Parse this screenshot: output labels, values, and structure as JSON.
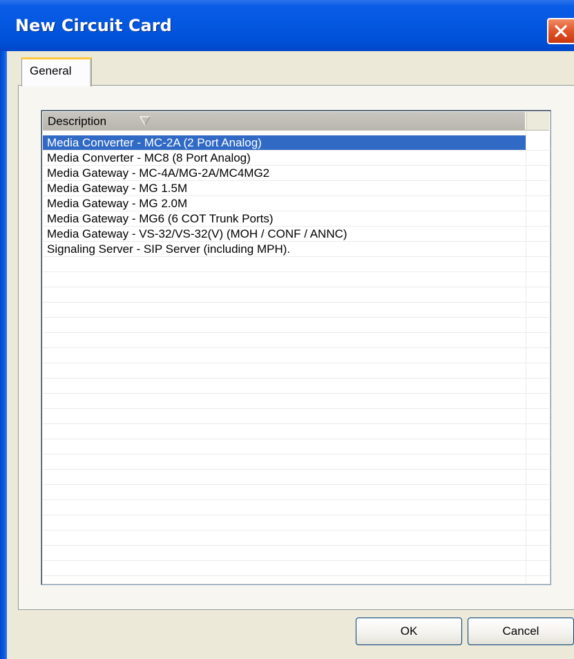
{
  "window": {
    "title": "New Circuit Card"
  },
  "tabs": [
    {
      "label": "General",
      "selected": true
    }
  ],
  "listview": {
    "columns": [
      {
        "label": "Description",
        "sort": "descending"
      }
    ],
    "rows": [
      {
        "label": "Media Converter - MC-2A (2 Port Analog)",
        "selected": true
      },
      {
        "label": "Media Converter - MC8 (8 Port Analog)",
        "selected": false
      },
      {
        "label": "Media Gateway - MC-4A/MG-2A/MC4MG2",
        "selected": false
      },
      {
        "label": "Media Gateway - MG 1.5M",
        "selected": false
      },
      {
        "label": "Media Gateway - MG 2.0M",
        "selected": false
      },
      {
        "label": "Media Gateway - MG6 (6 COT Trunk Ports)",
        "selected": false
      },
      {
        "label": "Media Gateway - VS-32/VS-32(V) (MOH / CONF / ANNC)",
        "selected": false
      },
      {
        "label": "Signaling Server - SIP Server (including MPH).",
        "selected": false
      }
    ],
    "empty_row_count": 22
  },
  "buttons": {
    "ok": "OK",
    "cancel": "Cancel"
  },
  "colors": {
    "titlebar": "#0458e0",
    "selection": "#316ac5",
    "dialog_bg": "#ece9d8",
    "close_button": "#e0542a"
  },
  "icons": {
    "close": "close-icon",
    "sort": "sort-descending-icon"
  }
}
